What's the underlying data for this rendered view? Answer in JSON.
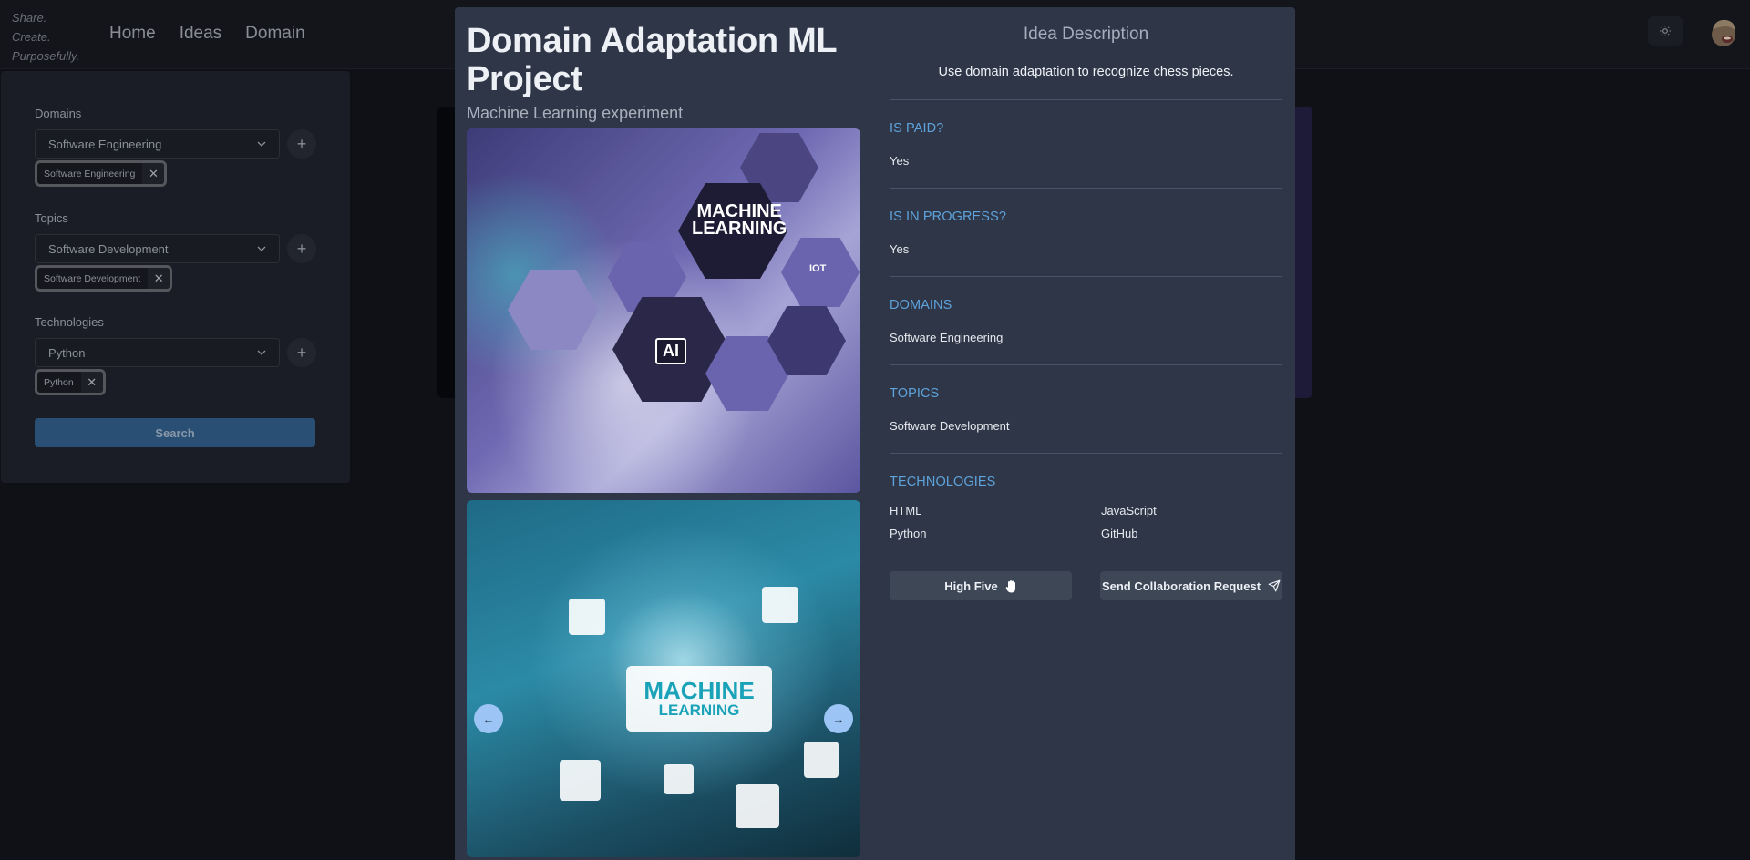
{
  "navbar": {
    "tagline": [
      "Share.",
      "Create.",
      "Purposefully."
    ],
    "links": [
      {
        "label": "Home"
      },
      {
        "label": "Ideas"
      },
      {
        "label": "Domain"
      }
    ],
    "theme_toggle_icon": "sun-icon",
    "avatar_icon": "user-avatar"
  },
  "sidebar": {
    "filters": [
      {
        "label": "Domains",
        "selected": "Software Engineering",
        "chips": [
          "Software Engineering"
        ]
      },
      {
        "label": "Topics",
        "selected": "Software Development",
        "chips": [
          "Software Development"
        ]
      },
      {
        "label": "Technologies",
        "selected": "Python",
        "chips": [
          "Python"
        ]
      }
    ],
    "add_label": "+",
    "chip_remove_label": "✕",
    "search_label": "Search"
  },
  "modal": {
    "title": "Domain Adaptation ML Project",
    "subtitle": "Machine Learning experiment",
    "images": [
      {
        "alt": "Machine Learning hexagon illustration",
        "caption_line1": "MACHINE",
        "caption_line2": "LEARNING",
        "badge": "AI",
        "iot": "IOT"
      },
      {
        "alt": "Machine Learning circuit illustration",
        "caption_line1": "MACHINE",
        "caption_line2": "LEARNING"
      }
    ],
    "carousel": {
      "prev_label": "←",
      "next_label": "→"
    },
    "description_title": "Idea Description",
    "description": "Use domain adaptation to recognize chess pieces.",
    "sections": [
      {
        "title": "IS PAID?",
        "value": "Yes"
      },
      {
        "title": "IS IN PROGRESS?",
        "value": "Yes"
      },
      {
        "title": "DOMAINS",
        "value": "Software Engineering"
      },
      {
        "title": "TOPICS",
        "value": "Software Development"
      }
    ],
    "technologies_title": "TECHNOLOGIES",
    "technologies": [
      "HTML",
      "JavaScript",
      "Python",
      "GitHub"
    ],
    "actions": {
      "high_five": "High Five",
      "collaboration": "Send Collaboration Request"
    }
  },
  "colors": {
    "accent": "#5ea3dc",
    "modal_bg": "#2e3647",
    "search_button": "#2a4f74",
    "carousel_button": "#9cc4f5"
  }
}
